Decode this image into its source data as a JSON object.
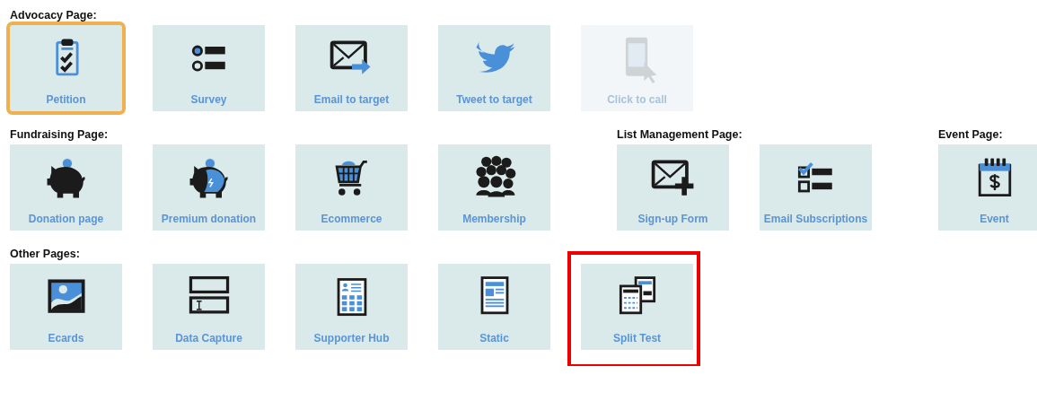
{
  "rows": [
    {
      "groups": [
        {
          "title": "Advocacy Page:",
          "tiles": [
            {
              "label": "Petition",
              "selected": true,
              "disabled": false,
              "marked": false
            },
            {
              "label": "Survey",
              "selected": false,
              "disabled": false,
              "marked": false
            },
            {
              "label": "Email to target",
              "selected": false,
              "disabled": false,
              "marked": false
            },
            {
              "label": "Tweet to target",
              "selected": false,
              "disabled": false,
              "marked": false
            },
            {
              "label": "Click to call",
              "selected": false,
              "disabled": true,
              "marked": false
            }
          ]
        }
      ]
    },
    {
      "groups": [
        {
          "title": "Fundraising Page:",
          "tiles": [
            {
              "label": "Donation page",
              "selected": false,
              "disabled": false,
              "marked": false
            },
            {
              "label": "Premium donation",
              "selected": false,
              "disabled": false,
              "marked": false
            },
            {
              "label": "Ecommerce",
              "selected": false,
              "disabled": false,
              "marked": false
            },
            {
              "label": "Membership",
              "selected": false,
              "disabled": false,
              "marked": false
            }
          ]
        },
        {
          "title": "List Management Page:",
          "tiles": [
            {
              "label": "Sign-up Form",
              "selected": false,
              "disabled": false,
              "marked": false
            },
            {
              "label": "Email Subscriptions",
              "selected": false,
              "disabled": false,
              "marked": false
            }
          ]
        },
        {
          "title": "Event Page:",
          "tiles": [
            {
              "label": "Event",
              "selected": false,
              "disabled": false,
              "marked": false
            }
          ]
        }
      ]
    },
    {
      "groups": [
        {
          "title": "Other Pages:",
          "tiles": [
            {
              "label": "Ecards",
              "selected": false,
              "disabled": false,
              "marked": false
            },
            {
              "label": "Data Capture",
              "selected": false,
              "disabled": false,
              "marked": false
            },
            {
              "label": "Supporter Hub",
              "selected": false,
              "disabled": false,
              "marked": false
            },
            {
              "label": "Static",
              "selected": false,
              "disabled": false,
              "marked": false
            },
            {
              "label": "Split Test",
              "selected": false,
              "disabled": false,
              "marked": true
            }
          ]
        }
      ]
    }
  ]
}
